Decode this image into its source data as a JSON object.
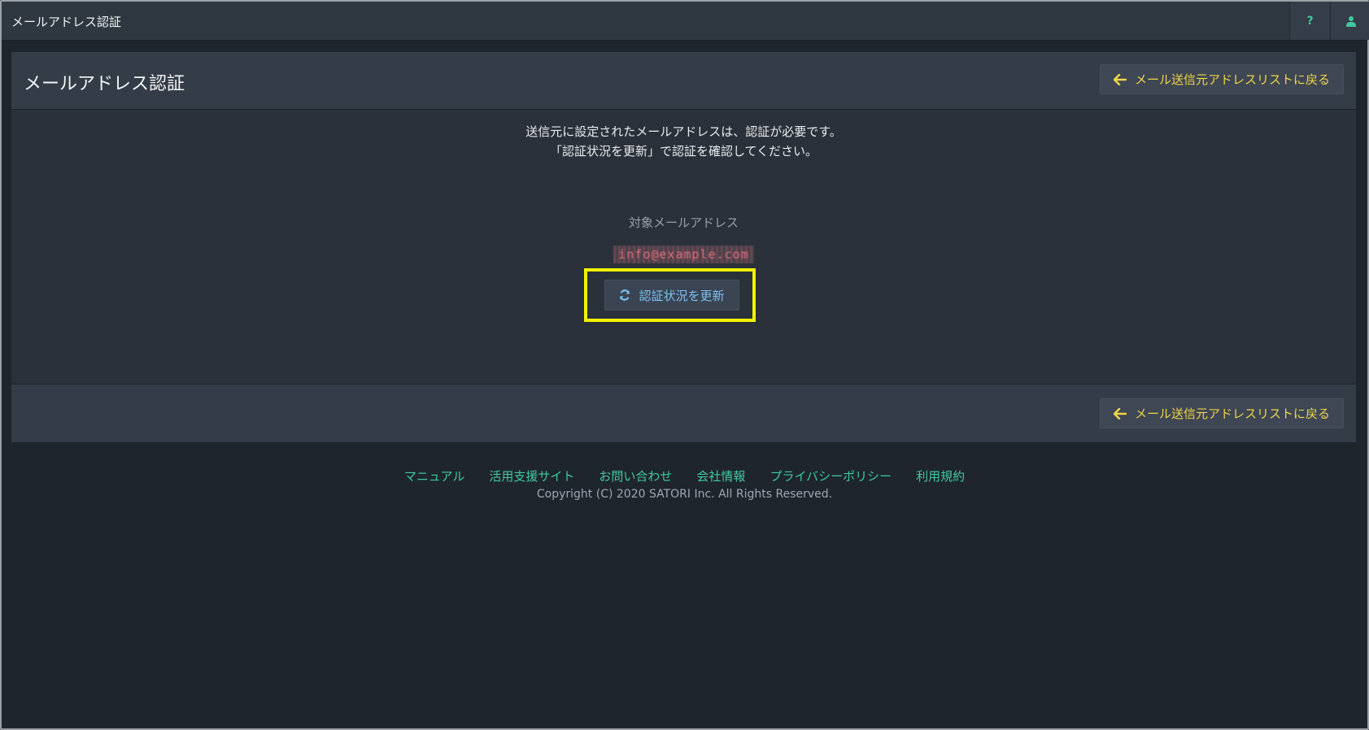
{
  "app": {
    "title": "メールアドレス認証"
  },
  "topbar": {
    "help_icon": "question-icon",
    "user_icon": "user-icon",
    "help_label": "?"
  },
  "page": {
    "title": "メールアドレス認証",
    "back_button_label": "メール送信元アドレスリストに戻る",
    "message_line1": "送信元に設定されたメールアドレスは、認証が必要です。",
    "message_line2": "「認証状況を更新」で認証を確認してください。",
    "target_label": "対象メールアドレス",
    "target_value": "info@example.com",
    "refresh_button_label": "認証状況を更新"
  },
  "footer": {
    "links": [
      "マニュアル",
      "活用支援サイト",
      "お問い合わせ",
      "会社情報",
      "プライバシーポリシー",
      "利用規約"
    ],
    "copyright": "Copyright (C) 2020 SATORI Inc. All Rights Reserved."
  },
  "colors": {
    "accent_green": "#3fc9a0",
    "button_yellow": "#f0d54a",
    "refresh_blue": "#7cc1f2",
    "highlight": "#f2f200"
  }
}
